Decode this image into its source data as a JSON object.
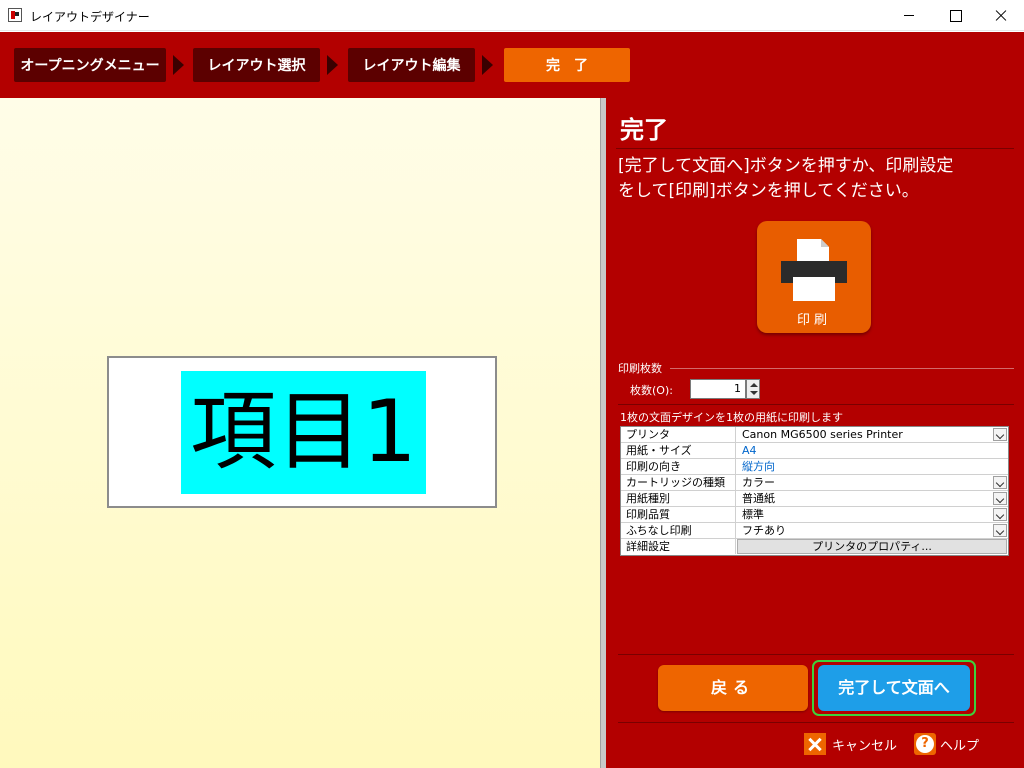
{
  "window": {
    "title": "レイアウトデザイナー",
    "app_icon": "layout-designer-icon"
  },
  "steps": [
    {
      "label": "オープニングメニュー",
      "current": false
    },
    {
      "label": "レイアウト選択",
      "current": false
    },
    {
      "label": "レイアウト編集",
      "current": false
    },
    {
      "label": "完　了",
      "current": true
    }
  ],
  "canvas": {
    "item_text": "項目1",
    "item_background": "#00ffff"
  },
  "panel": {
    "title": "完了",
    "instruction_line1": "[完了して文面へ]ボタンを押すか、印刷設定",
    "instruction_line2": "をして[印刷]ボタンを押してください。",
    "print_button_label": "印刷",
    "copies_section": "印刷枚数",
    "copies_label": "枚数(O):",
    "copies_value": "1",
    "grid_caption": "1枚の文面デザインを1枚の用紙に印刷します",
    "settings": [
      {
        "label": "プリンタ",
        "value": "Canon MG6500 series Printer",
        "type": "dropdown"
      },
      {
        "label": "用紙・サイズ",
        "value": "A4",
        "type": "link"
      },
      {
        "label": "印刷の向き",
        "value": "縦方向",
        "type": "link"
      },
      {
        "label": "カートリッジの種類",
        "value": "カラー",
        "type": "dropdown"
      },
      {
        "label": "用紙種別",
        "value": "普通紙",
        "type": "dropdown"
      },
      {
        "label": "印刷品質",
        "value": "標準",
        "type": "dropdown"
      },
      {
        "label": "ふちなし印刷",
        "value": "フチあり",
        "type": "dropdown"
      },
      {
        "label": "詳細設定",
        "value": "プリンタのプロパティ...",
        "type": "button"
      }
    ],
    "back_label": "戻る",
    "finish_label": "完了して文面へ",
    "cancel_label": "キャンセル",
    "help_label": "ヘルプ"
  },
  "colors": {
    "brand_red": "#b30000",
    "step_dark": "#5c0000",
    "accent_orange": "#ee6500",
    "finish_blue": "#1e9ee8",
    "focus_green": "#3cd23c"
  }
}
